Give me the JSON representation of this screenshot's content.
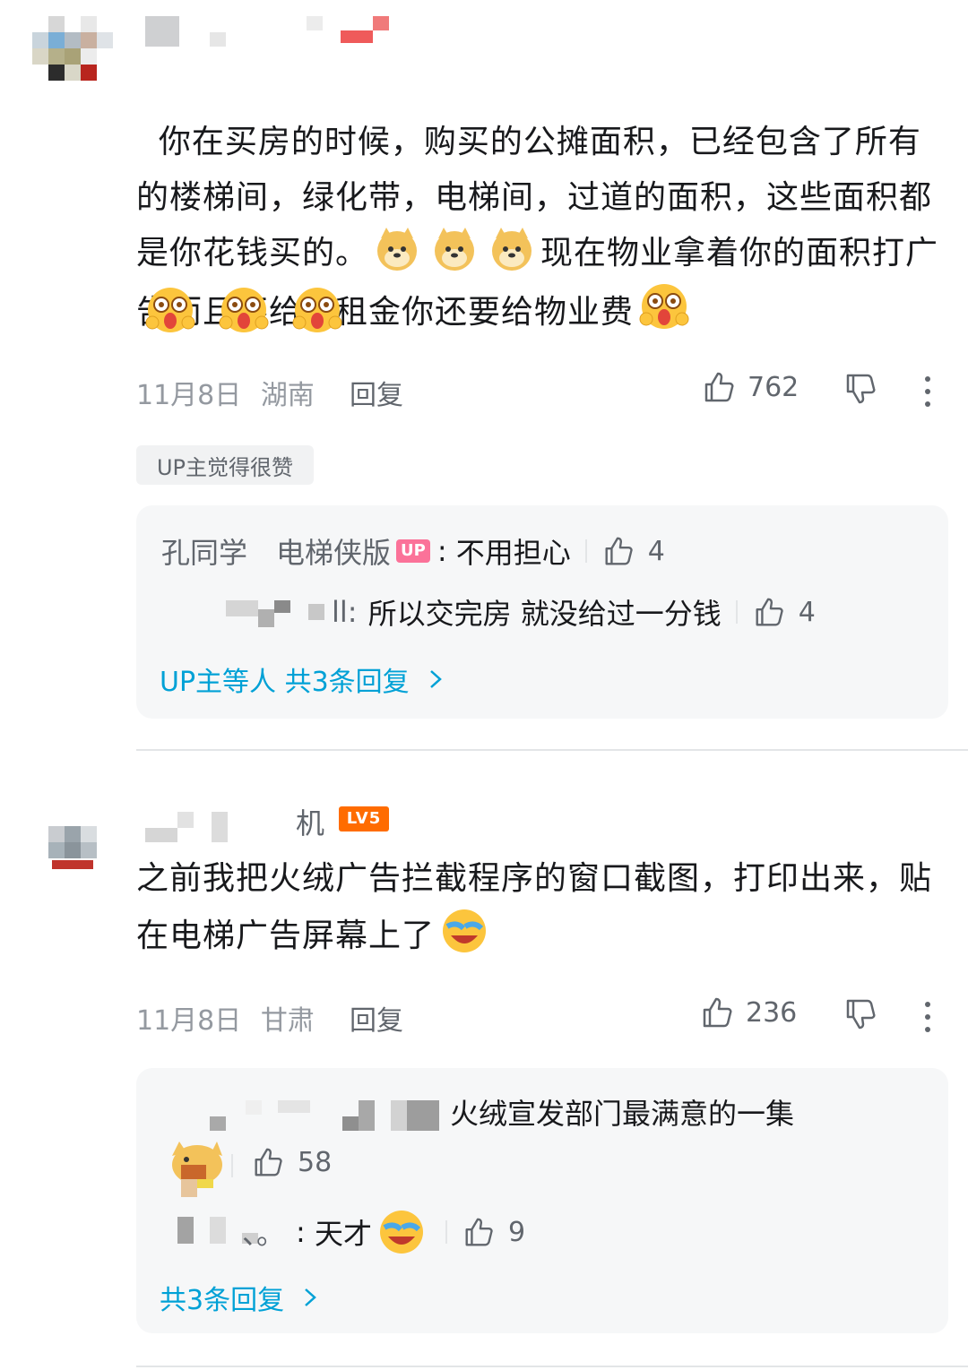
{
  "comments": [
    {
      "text_before": "你在买房的时候，购买的公摊面积，已经包含了所有的楼梯间，绿化带，电梯间，过道的面积，这些面积都是你花钱买的。",
      "text_middle": "现在物业拿着你的面积打广告而且不给你租金你还要给物业费",
      "date": "11月8日",
      "location": "湖南",
      "reply_label": "回复",
      "likes": "762",
      "badge": "UP主觉得很赞",
      "replies": [
        {
          "name": "孔同学　电梯侠版",
          "badge": "UP",
          "text": "不用担心",
          "likes": "4"
        },
        {
          "name": "ll:",
          "text": "所以交完房 就没给过一分钱",
          "likes": "4"
        }
      ],
      "more_replies": "UP主等人 共3条回复"
    },
    {
      "name_fragment": "机",
      "level": "LV5",
      "text": "之前我把火绒广告拦截程序的窗口截图，打印出来，贴在电梯广告屏幕上了",
      "date": "11月8日",
      "location": "甘肃",
      "reply_label": "回复",
      "likes": "236",
      "replies": [
        {
          "text": "火绒宣发部门最满意的一集",
          "likes": "58"
        },
        {
          "name": "、。",
          "text": "天才",
          "likes": "9"
        }
      ],
      "more_replies": "共3条回复"
    }
  ],
  "icons": [
    "like-icon",
    "dislike-icon",
    "more-icon",
    "chevron-right-icon",
    "doge-emoji",
    "shock-emoji",
    "laugh-cry-emoji"
  ]
}
